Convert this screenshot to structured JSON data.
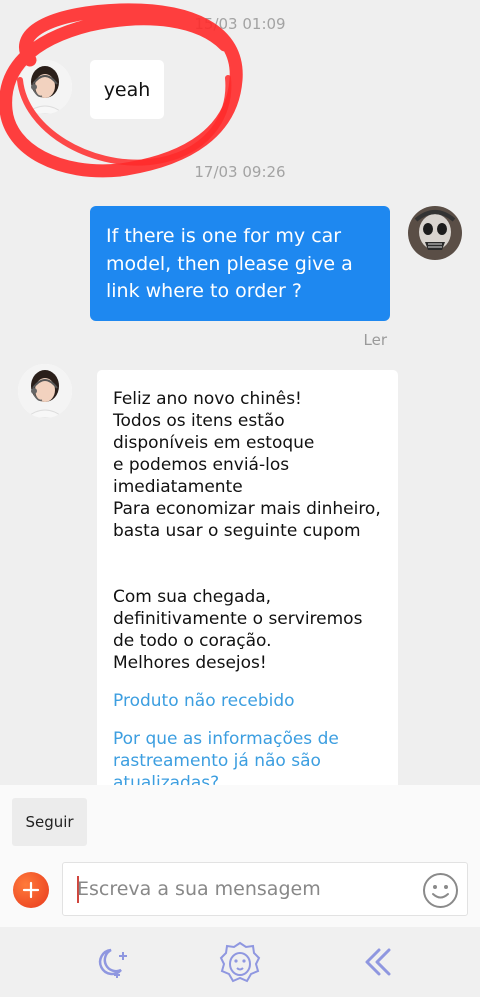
{
  "chat": {
    "timestamp_1": "15/03 01:09",
    "message_1": "yeah",
    "timestamp_2": "17/03 09:26",
    "outgoing_message": {
      "lines": [
        "If there is one for my car",
        "model, then please give a",
        "link where to order ?"
      ],
      "status": "Ler"
    },
    "incoming_message": {
      "lines_a": [
        "Feliz ano novo chinês!",
        "Todos os itens estão",
        "disponíveis em estoque",
        "e podemos enviá-los",
        "imediatamente",
        "Para economizar mais dinheiro,",
        "basta usar o seguinte cupom"
      ],
      "lines_b": [
        "Com sua chegada,",
        "definitivamente o serviremos",
        "de todo o coração.",
        "Melhores desejos!"
      ],
      "link_1": "Produto não recebido",
      "link_2_lines": [
        "Por que as informações de",
        "rastreamento já não são",
        "atualizadas?"
      ]
    }
  },
  "follow_bar": {
    "follow_label": "Seguir"
  },
  "input_bar": {
    "placeholder": "Escreva a sua mensagem"
  },
  "colors": {
    "outgoing_bubble": "#1e88f0",
    "link": "#3c9ee0",
    "annotation": "#ff2a2a",
    "nav_icon": "#8f97e0"
  },
  "icons": [
    "agent-avatar",
    "user-avatar",
    "plus-icon",
    "emoji-icon",
    "moon-star-icon",
    "lion-icon",
    "double-chevron-left-icon"
  ]
}
